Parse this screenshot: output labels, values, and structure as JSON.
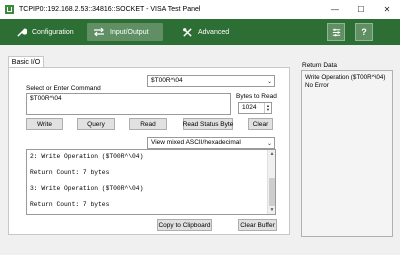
{
  "window": {
    "title": "TCPIP0::192.168.2.53::34816::SOCKET - VISA Test Panel",
    "minimize_glyph": "—",
    "maximize_glyph": "☐",
    "close_glyph": "✕"
  },
  "toolbar": {
    "configuration_label": "Configuration",
    "input_output_label": "Input/Output",
    "advanced_label": "Advanced",
    "help_label": "?",
    "accent_color": "#2d6e35"
  },
  "basic_io": {
    "tab_label": "Basic I/O",
    "command_combo_value": "$T00R^\\04",
    "command_label": "Select or Enter Command",
    "command_value": "$T00R^\\04",
    "bytes_label": "Bytes to Read",
    "bytes_value": "1024",
    "buttons": {
      "write": "Write",
      "query": "Query",
      "read": "Read",
      "read_status_byte": "Read Status Byte",
      "clear": "Clear"
    },
    "view_mode_value": "View mixed ASCII/hexadecimal",
    "output_lines": [
      "2: Write Operation ($T00R^\\04)",
      "",
      "Return Count: 7 bytes",
      "",
      "3: Write Operation ($T00R^\\04)",
      "",
      "Return Count: 7 bytes"
    ],
    "copy_button": "Copy to Clipboard",
    "clear_buffer_button": "Clear Buffer"
  },
  "return_data": {
    "title": "Return Data",
    "lines": [
      "Write Operation ($T00R^\\04)",
      "No Error"
    ]
  }
}
